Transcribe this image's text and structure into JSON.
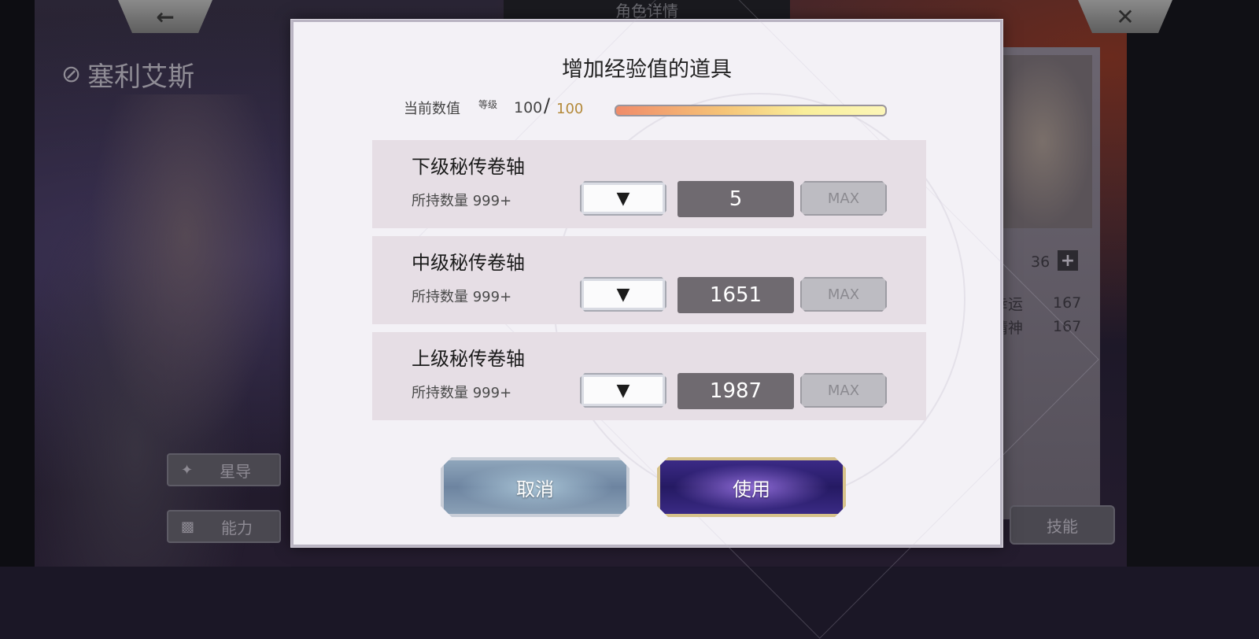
{
  "background": {
    "character_name": "塞利艾斯",
    "header_tab": "角色详情",
    "back_icon": "←",
    "close_icon": "✕",
    "star_button": "星导",
    "ability_button": "能力",
    "skill_button": "技能",
    "stat_top_value": "36",
    "stat_luck_label": "幸运",
    "stat_luck_value": "167",
    "stat_spirit_label": "精神",
    "stat_spirit_value": "167",
    "plus_icon": "+"
  },
  "modal": {
    "title": "增加经验值的道具",
    "current_label": "当前数值",
    "level_label": "等级",
    "level_current": "100",
    "level_slash": "/",
    "level_max": "100",
    "exp_progress": 1.0,
    "items": [
      {
        "name": "下级秘传卷轴",
        "owned": "所持数量 999+",
        "quantity": "5",
        "max_label": "MAX",
        "dropdown_icon": "▼"
      },
      {
        "name": "中级秘传卷轴",
        "owned": "所持数量 999+",
        "quantity": "1651",
        "max_label": "MAX",
        "dropdown_icon": "▼"
      },
      {
        "name": "上级秘传卷轴",
        "owned": "所持数量 999+",
        "quantity": "1987",
        "max_label": "MAX",
        "dropdown_icon": "▼"
      }
    ],
    "cancel_label": "取消",
    "use_label": "使用"
  }
}
